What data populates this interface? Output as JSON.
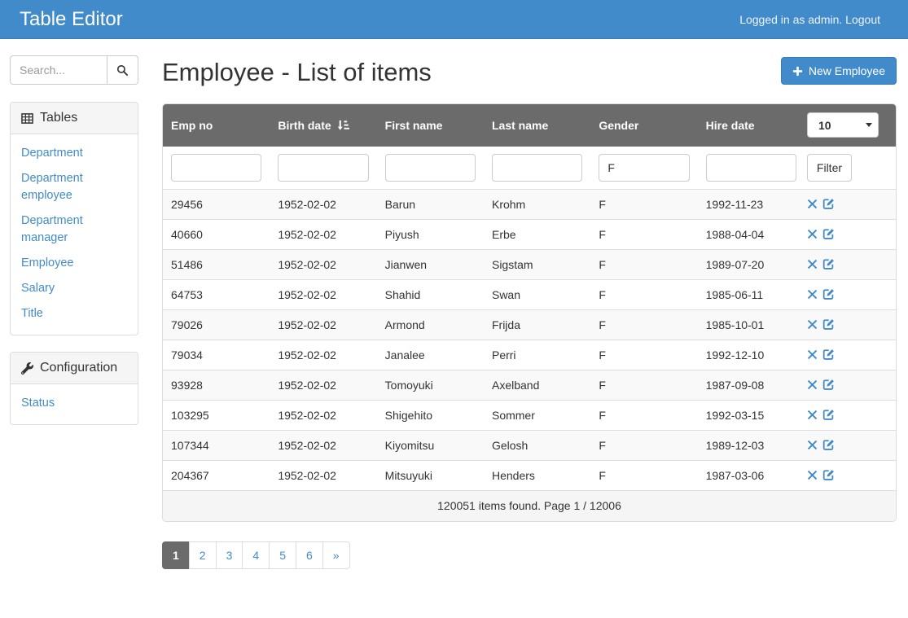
{
  "navbar": {
    "brand": "Table Editor",
    "status_text": "Logged in as admin.",
    "logout_label": "Logout"
  },
  "sidebar": {
    "search": {
      "placeholder": "Search..."
    },
    "tables_panel": {
      "title": "Tables",
      "items": [
        "Department",
        "Department employee",
        "Department manager",
        "Employee",
        "Salary",
        "Title"
      ]
    },
    "config_panel": {
      "title": "Configuration",
      "items": [
        "Status"
      ]
    }
  },
  "main": {
    "title": "Employee - List of items",
    "new_button_label": "New Employee",
    "table": {
      "columns": [
        {
          "label": "Emp no",
          "sorted": false
        },
        {
          "label": "Birth date",
          "sorted": true
        },
        {
          "label": "First name",
          "sorted": false
        },
        {
          "label": "Last name",
          "sorted": false
        },
        {
          "label": "Gender",
          "sorted": false
        },
        {
          "label": "Hire date",
          "sorted": false
        }
      ],
      "page_size": "10",
      "filters": [
        "",
        "",
        "",
        "",
        "F",
        ""
      ],
      "filter_button_label": "Filter",
      "rows": [
        {
          "emp_no": "29456",
          "birth_date": "1952-02-02",
          "first_name": "Barun",
          "last_name": "Krohm",
          "gender": "F",
          "hire_date": "1992-11-23"
        },
        {
          "emp_no": "40660",
          "birth_date": "1952-02-02",
          "first_name": "Piyush",
          "last_name": "Erbe",
          "gender": "F",
          "hire_date": "1988-04-04"
        },
        {
          "emp_no": "51486",
          "birth_date": "1952-02-02",
          "first_name": "Jianwen",
          "last_name": "Sigstam",
          "gender": "F",
          "hire_date": "1989-07-20"
        },
        {
          "emp_no": "64753",
          "birth_date": "1952-02-02",
          "first_name": "Shahid",
          "last_name": "Swan",
          "gender": "F",
          "hire_date": "1985-06-11"
        },
        {
          "emp_no": "79026",
          "birth_date": "1952-02-02",
          "first_name": "Armond",
          "last_name": "Frijda",
          "gender": "F",
          "hire_date": "1985-10-01"
        },
        {
          "emp_no": "79034",
          "birth_date": "1952-02-02",
          "first_name": "Janalee",
          "last_name": "Perri",
          "gender": "F",
          "hire_date": "1992-12-10"
        },
        {
          "emp_no": "93928",
          "birth_date": "1952-02-02",
          "first_name": "Tomoyuki",
          "last_name": "Axelband",
          "gender": "F",
          "hire_date": "1987-09-08"
        },
        {
          "emp_no": "103295",
          "birth_date": "1952-02-02",
          "first_name": "Shigehito",
          "last_name": "Sommer",
          "gender": "F",
          "hire_date": "1992-03-15"
        },
        {
          "emp_no": "107344",
          "birth_date": "1952-02-02",
          "first_name": "Kiyomitsu",
          "last_name": "Gelosh",
          "gender": "F",
          "hire_date": "1989-12-03"
        },
        {
          "emp_no": "204367",
          "birth_date": "1952-02-02",
          "first_name": "Mitsuyuki",
          "last_name": "Henders",
          "gender": "F",
          "hire_date": "1987-03-06"
        }
      ],
      "footer": "120051 items found. Page 1 / 12006"
    },
    "pagination": {
      "pages": [
        {
          "label": "1",
          "active": true
        },
        {
          "label": "2",
          "active": false
        },
        {
          "label": "3",
          "active": false
        },
        {
          "label": "4",
          "active": false
        },
        {
          "label": "5",
          "active": false
        },
        {
          "label": "6",
          "active": false
        },
        {
          "label": "»",
          "active": false
        }
      ]
    }
  },
  "colors": {
    "accent_blue": "#428bca",
    "table_header_gray": "#6b6b6b",
    "stripe_gray": "#f9f9f9",
    "panel_heading_gray": "#f5f5f5"
  }
}
